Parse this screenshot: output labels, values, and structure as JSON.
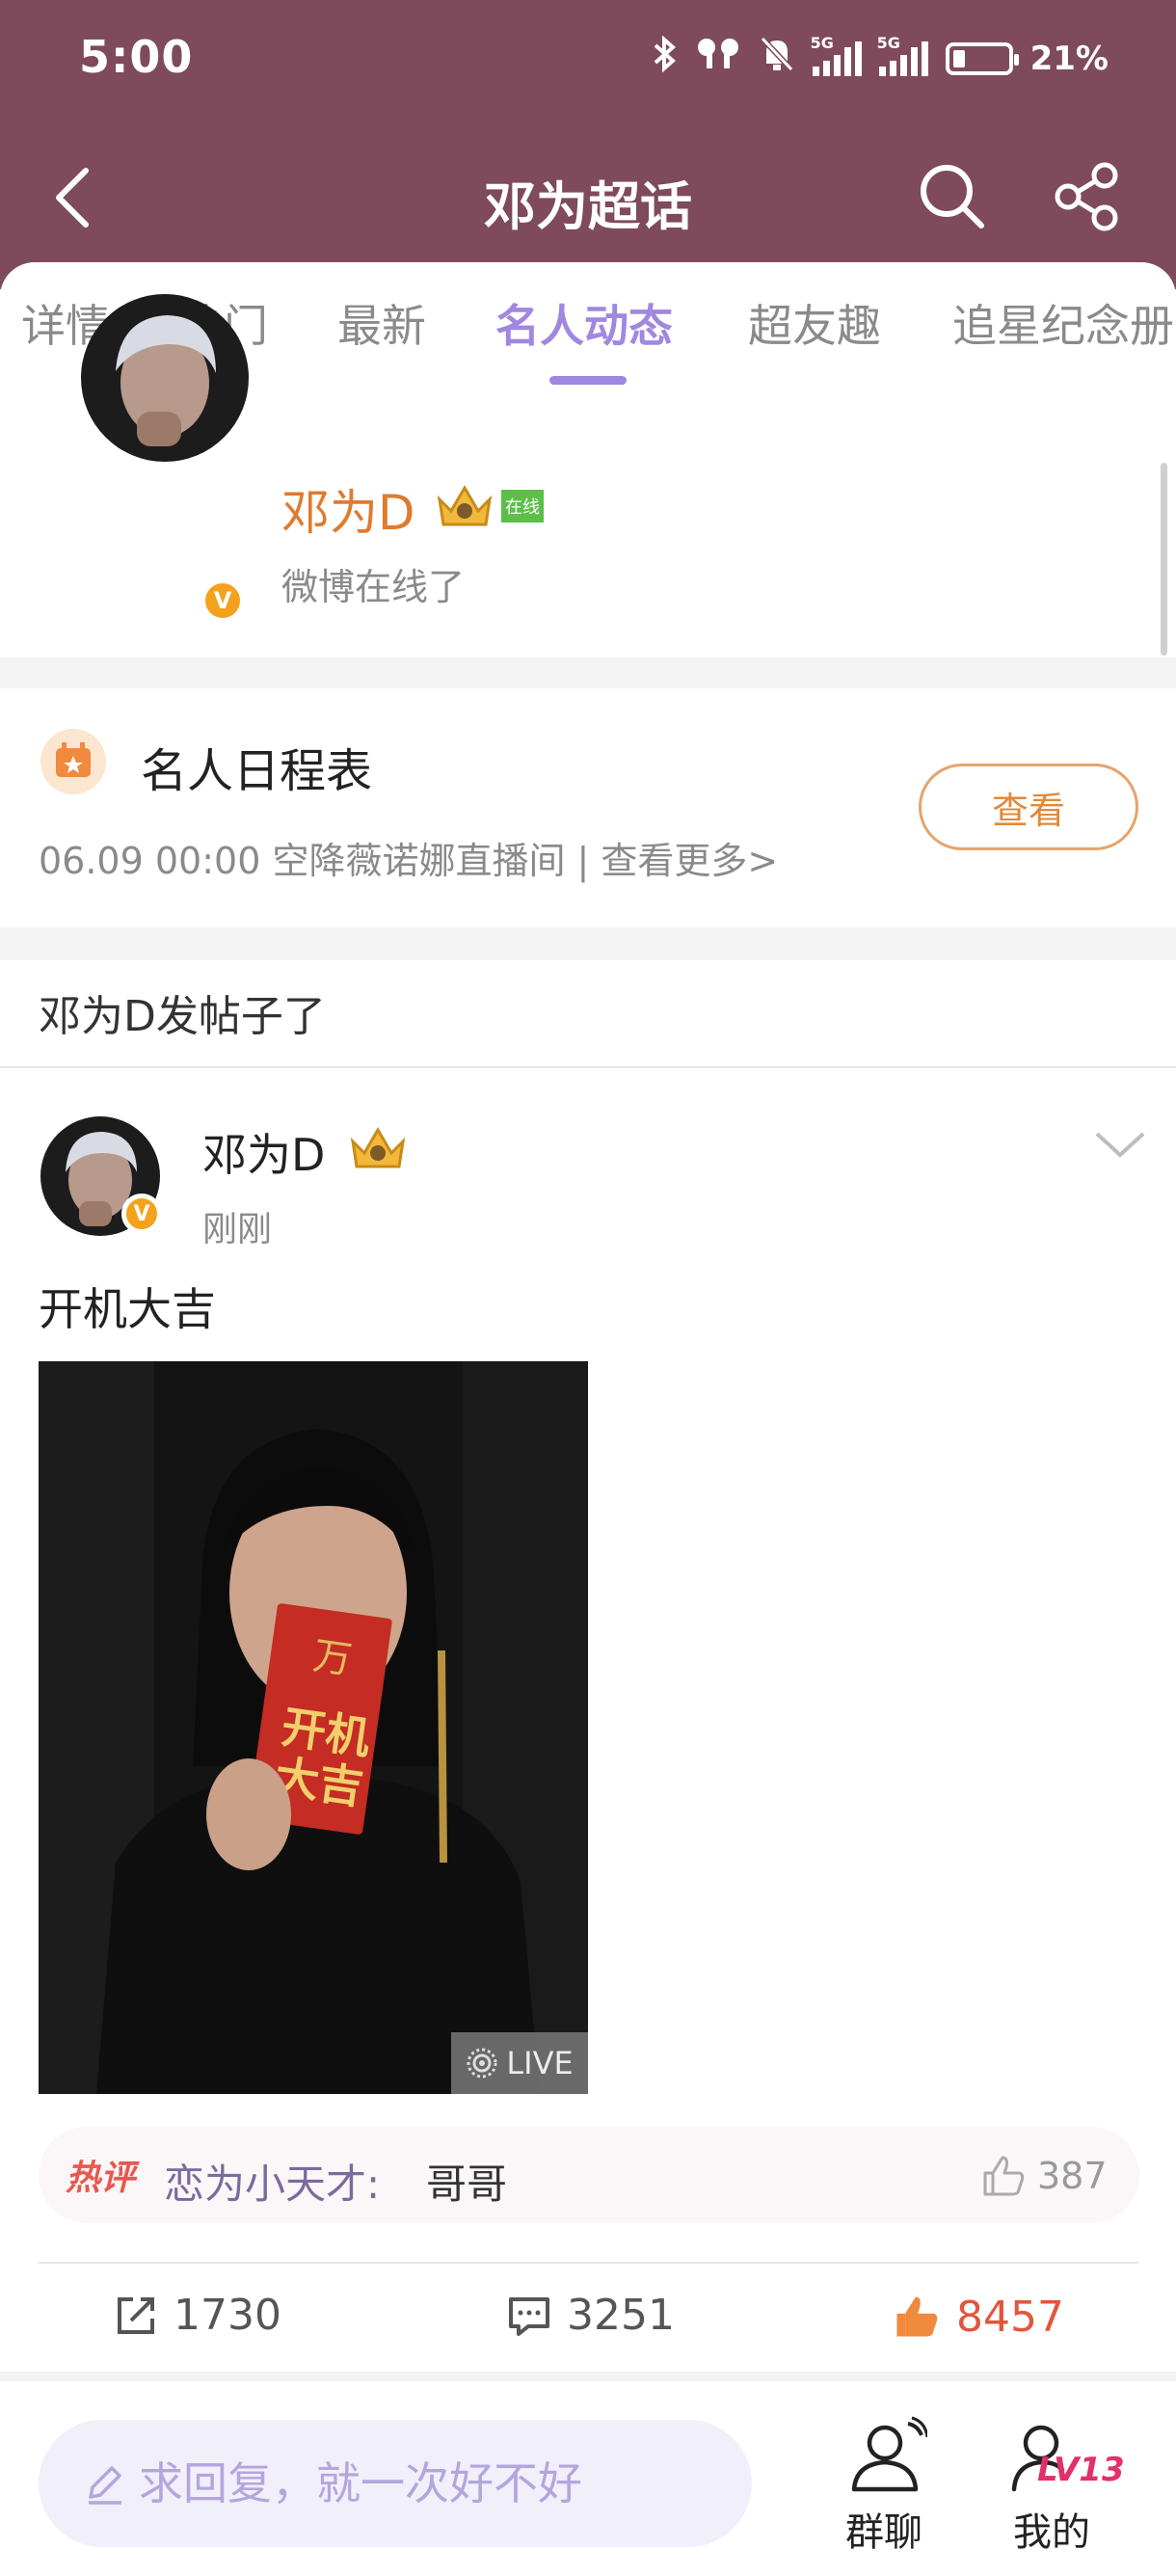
{
  "status_bar": {
    "time": "5:00",
    "network_1": "5G",
    "network_2": "5G",
    "battery": "21%"
  },
  "nav": {
    "title": "邓为超话"
  },
  "tabs": [
    {
      "label": "详情"
    },
    {
      "label": "热门"
    },
    {
      "label": "最新"
    },
    {
      "label": "名人动态",
      "active": true
    },
    {
      "label": "超友趣"
    },
    {
      "label": "追星纪念册"
    }
  ],
  "celeb": {
    "name": "邓为D",
    "online_badge": "在线",
    "status": "微博在线了",
    "verified_badge": "V"
  },
  "schedule": {
    "title": "名人日程表",
    "detail": "06.09 00:00 空降薇诺娜直播间 |  查看更多>",
    "button": "查看"
  },
  "section": {
    "title": "邓为D发帖子了"
  },
  "post": {
    "author": "邓为D",
    "time": "刚刚",
    "text": "开机大吉",
    "image_badge": "LIVE",
    "hot_comment": {
      "tag": "热评",
      "user": "恋为小天才:",
      "text": "哥哥",
      "likes": "387"
    },
    "actions": {
      "reposts": "1730",
      "comments": "3251",
      "likes": "8457"
    }
  },
  "bottom_bar": {
    "reply_placeholder": "求回复，就一次好不好",
    "group_chat": "群聊",
    "me": "我的",
    "level": "LV13"
  },
  "colors": {
    "header_bg": "#7e4a5c",
    "tab_active": "#a087df",
    "celeb_name": "#e07a2e",
    "liked": "#e1563c"
  }
}
